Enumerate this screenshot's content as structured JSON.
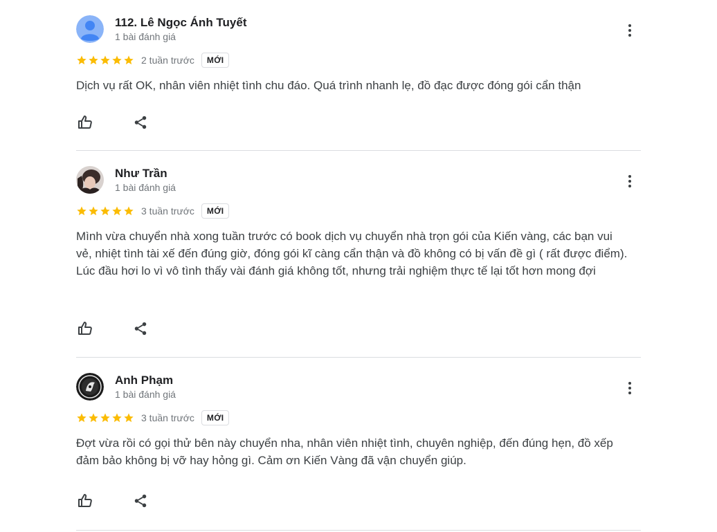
{
  "reviews": [
    {
      "author": "112. Lê Ngọc Ánh Tuyết",
      "meta": "1 bài đánh giá",
      "rating": 5,
      "time": "2 tuần trước",
      "badge": "MỚI",
      "text": "Dịch vụ rất OK, nhân viên nhiệt tình chu đáo. Quá trình nhanh lẹ, đồ đạc được đóng gói cẩn thận",
      "avatar": "default-person-avatar"
    },
    {
      "author": "Như Trần",
      "meta": "1 bài đánh giá",
      "rating": 5,
      "time": "3 tuần trước",
      "badge": "MỚI",
      "text": "Mình vừa chuyển nhà xong tuần trước có book dịch vụ chuyển nhà trọn gói của Kiến vàng, các bạn vui vẻ, nhiệt tình tài xế đến đúng giờ, đóng gói kĩ càng cẩn thận và đồ không có bị vấn đề gì ( rất được điểm). Lúc đầu hơi lo vì vô tình thấy vài đánh giá không tốt, nhưng trải nghiệm thực tế lại tốt hơn mong đợi",
      "avatar": "photo-avatar"
    },
    {
      "author": "Anh Phạm",
      "meta": "1 bài đánh giá",
      "rating": 5,
      "time": "3 tuần trước",
      "badge": "MỚI",
      "text": "Đợt vừa rồi có gọi thử bên này chuyển nha, nhân viên nhiệt tình, chuyên nghiệp, đến đúng hẹn, đồ xếp đảm bảo không bị vỡ hay hỏng gì. Cảm ơn Kiến Vàng đã vận chuyển giúp.",
      "avatar": "emblem-avatar"
    }
  ],
  "icons": {
    "like": "thumb-up-icon",
    "share": "share-icon",
    "menu": "more-vert-icon",
    "star": "star-icon"
  },
  "colors": {
    "star": "#fbbc04",
    "default_avatar": "#8ab4f8",
    "divider": "#dadce0"
  }
}
